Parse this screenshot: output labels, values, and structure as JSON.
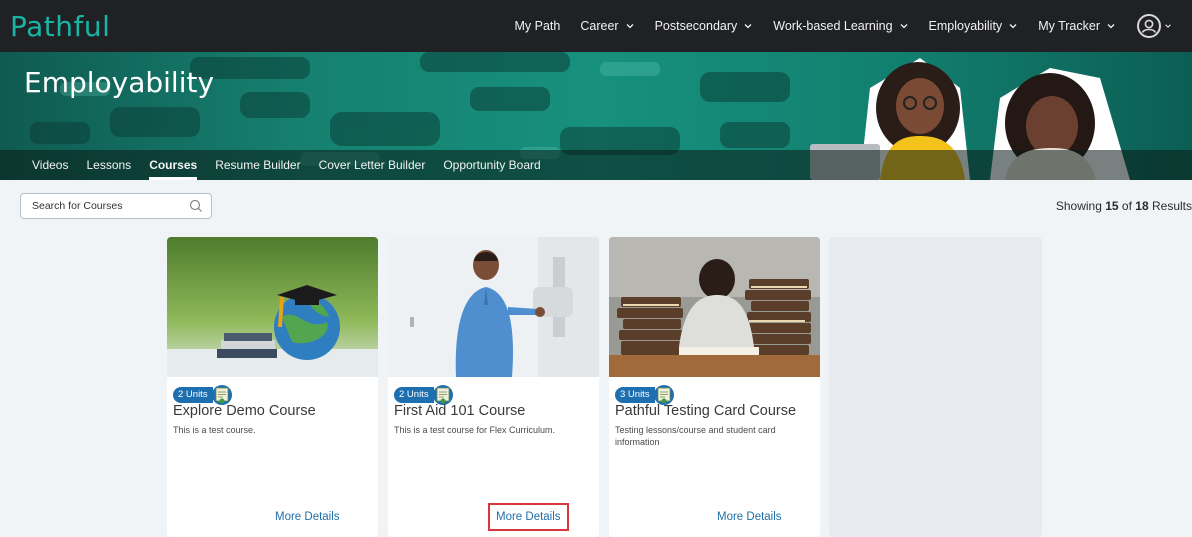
{
  "app": {
    "logo": "Pathful"
  },
  "nav": {
    "items": [
      {
        "label": "My Path",
        "dropdown": false
      },
      {
        "label": "Career",
        "dropdown": true
      },
      {
        "label": "Postsecondary",
        "dropdown": true
      },
      {
        "label": "Work-based Learning",
        "dropdown": true
      },
      {
        "label": "Employability",
        "dropdown": true
      },
      {
        "label": "My Tracker",
        "dropdown": true
      }
    ],
    "avatar_icon": "user-circle-icon"
  },
  "banner": {
    "title": "Employability",
    "tabs": [
      {
        "label": "Videos",
        "active": false
      },
      {
        "label": "Lessons",
        "active": false
      },
      {
        "label": "Courses",
        "active": true
      },
      {
        "label": "Resume Builder",
        "active": false
      },
      {
        "label": "Cover Letter Builder",
        "active": false
      },
      {
        "label": "Opportunity Board",
        "active": false
      }
    ]
  },
  "search": {
    "placeholder": "Search for Courses",
    "value": ""
  },
  "results": {
    "prefix": "Showing ",
    "shown": "15",
    "middle": " of ",
    "total": "18",
    "suffix": " Results"
  },
  "courses": [
    {
      "units": "2 Units",
      "title": "Explore Demo Course",
      "description": "This is a test course.",
      "more": "More Details",
      "image": "graduation-globe-image"
    },
    {
      "units": "2 Units",
      "title": "First Aid 101 Course",
      "description": "This is a test course for Flex Curriculum.",
      "more": "More Details",
      "image": "medical-technician-image"
    },
    {
      "units": "3 Units",
      "title": "Pathful Testing Card Course",
      "description": "Testing lessons/course and student card information",
      "more": "More Details",
      "image": "student-books-image"
    }
  ],
  "colors": {
    "topbar": "#1f2125",
    "brand": "#1ab4a4",
    "banner": "#17907e",
    "link": "#1f6fa8",
    "badge": "#1e6fb0",
    "highlight": "#d9363e"
  }
}
